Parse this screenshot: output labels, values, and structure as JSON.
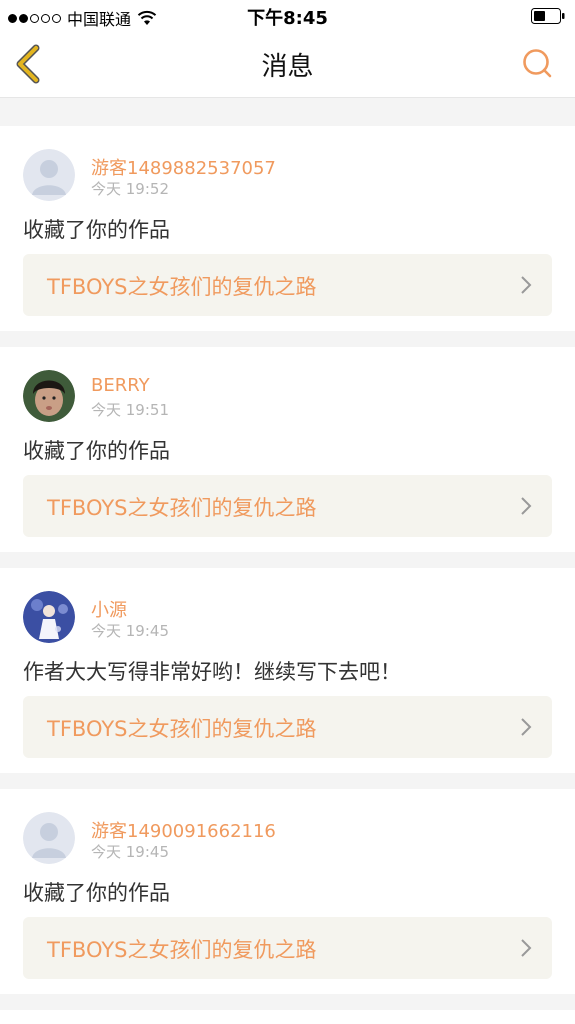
{
  "status_bar": {
    "carrier": "中国联通",
    "time": "下午8:45"
  },
  "nav": {
    "title": "消息"
  },
  "colors": {
    "accent": "#f09a5e",
    "back_icon": "#e3b51f",
    "link_bg": "#f5f4ee",
    "separator": "#f4f4f4"
  },
  "messages": [
    {
      "avatar": "default-avatar",
      "username": "游客1489882537057",
      "time": "今天 19:52",
      "content": "收藏了你的作品",
      "work_title": "TFBOYS之女孩们的复仇之路"
    },
    {
      "avatar": "photo-avatar",
      "username": "BERRY",
      "time": "今天 19:51",
      "content": "收藏了你的作品",
      "work_title": "TFBOYS之女孩们的复仇之路"
    },
    {
      "avatar": "photo-avatar",
      "username": "小源",
      "time": "今天 19:45",
      "content": "作者大大写得非常好哟！继续写下去吧！",
      "work_title": "TFBOYS之女孩们的复仇之路"
    },
    {
      "avatar": "default-avatar",
      "username": "游客1490091662116",
      "time": "今天 19:45",
      "content": "收藏了你的作品",
      "work_title": "TFBOYS之女孩们的复仇之路"
    }
  ]
}
